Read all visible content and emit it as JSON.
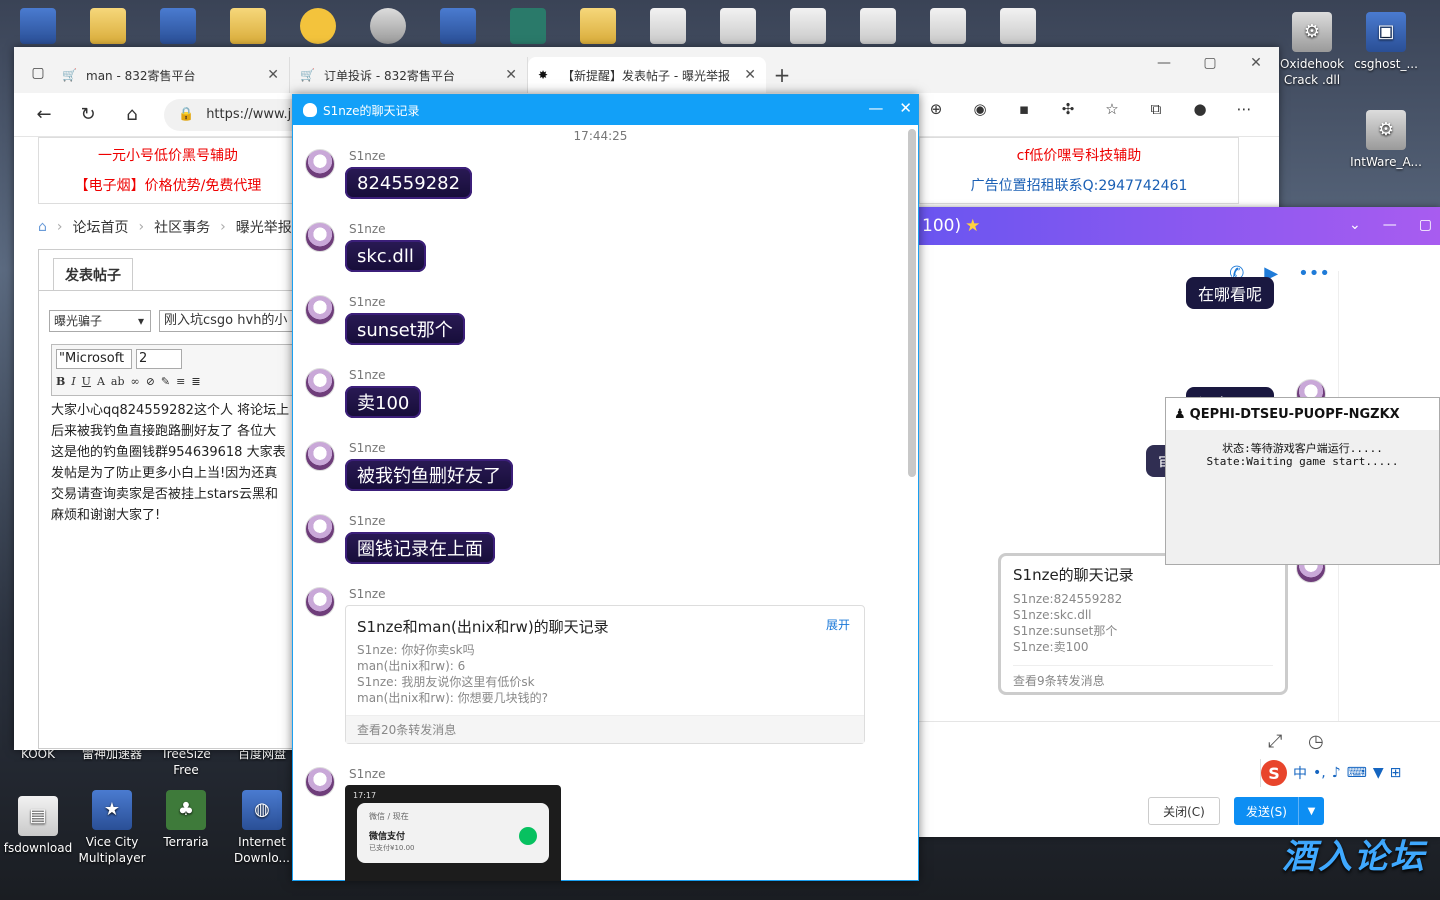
{
  "desktop": {
    "icons": [
      {
        "label": "Oxidehook Crack .dll",
        "type": "gear"
      },
      {
        "label": "csghost_...",
        "type": "app"
      },
      {
        "label": "IntWare_A...",
        "type": "gear"
      },
      {
        "label": "fsdownload",
        "type": "doc"
      },
      {
        "label": "Vice City Multiplayer",
        "type": "app"
      },
      {
        "label": "Terraria",
        "type": "app"
      },
      {
        "label": "Internet Downlo...",
        "type": "app"
      }
    ],
    "cut_labels": [
      "KOOK",
      "雷神加速器",
      "TreeSize Free",
      "百度网盘"
    ],
    "watermark": "酒入论坛"
  },
  "browser": {
    "tabs": [
      {
        "title": "man - 832寄售平台"
      },
      {
        "title": "订单投诉 - 832寄售平台"
      },
      {
        "title": "【新提醒】发表帖子 - 曝光举报"
      }
    ],
    "url": "https://www.jr"
  },
  "page": {
    "ad_left": [
      "一元小号低价黑号辅助",
      "【电子烟】价格优势/免费代理"
    ],
    "ad_right": [
      "cf低价嘿号科技辅助",
      "广告位置招租联系Q:2947742461"
    ],
    "breadcrumb": [
      "论坛首页",
      "社区事务",
      "曝光举报"
    ],
    "post_tab": "发表帖子",
    "category": "曝光骗子",
    "title_value": "刚入坑csgo hvh的小",
    "font": "\"Microsoft",
    "size": "2",
    "body_lines": [
      "大家小心qq824559282这个人 将论坛上",
      "后来被我钓鱼直接跑路删好友了 各位大",
      "这是他的钓鱼圈钱群954639618 大家表",
      "发帖是为了防止更多小白上当!因为还真",
      "交易请查询卖家是否被挂上stars云黑和",
      "麻烦和谢谢大家了!"
    ]
  },
  "qq_bg": {
    "title": "100)",
    "bubbles": [
      "在哪看呢",
      "问客服呢",
      "审核一下"
    ],
    "forward": {
      "title": "S1nze的聊天记录",
      "lines": [
        "S1nze:824559282",
        "S1nze:skc.dll",
        "S1nze:sunset那个",
        "S1nze:卖100"
      ],
      "footer": "查看9条转发消息"
    },
    "close_label": "关闭(C)",
    "send_label": "发送(S)",
    "ime": "中"
  },
  "game_popup": {
    "title": "QEPHI-DTSEU-PUOPF-NGZKX",
    "status_cn": "状态:等待游戏客户端运行.....",
    "status_en": "State:Waiting game start....."
  },
  "chat_record": {
    "window_title": "S1nze的聊天记录",
    "time": "17:44:25",
    "sender": "S1nze",
    "messages": [
      "824559282",
      "skc.dll",
      "sunset那个",
      "卖100",
      "被我钓鱼删好友了",
      "圈钱记录在上面"
    ],
    "nested": {
      "title": "S1nze和man(出nix和rw)的聊天记录",
      "expand": "展开",
      "lines": [
        "S1nze:  你好你卖sk吗",
        "man(出nix和rw):  6",
        "S1nze:  我朋友说你这里有低价sk",
        "man(出nix和rw):  你想要几块钱的?"
      ],
      "footer": "查看20条转发消息"
    },
    "screenshot": {
      "status": "17:17",
      "app": "微信 / 现在",
      "title": "微信支付",
      "detail": "已支付¥10.00"
    }
  }
}
